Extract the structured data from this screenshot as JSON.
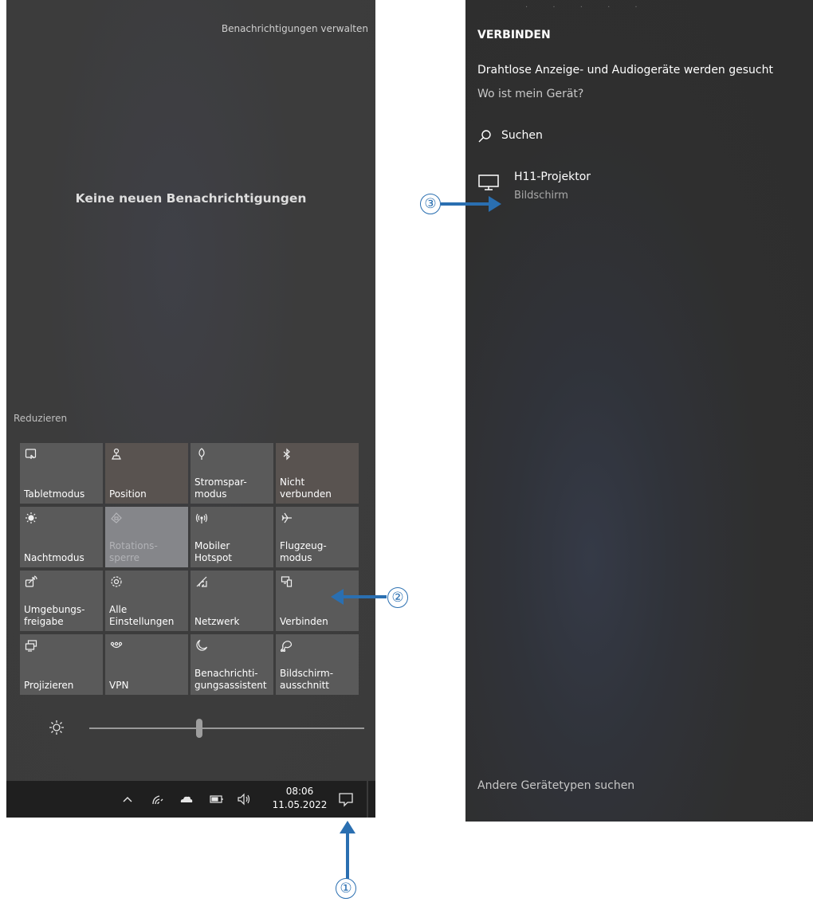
{
  "action_center": {
    "manage_notifications": "Benachrichtigungen verwalten",
    "empty_message": "Keine neuen Benachrichtigungen",
    "collapse": "Reduzieren",
    "tiles": [
      {
        "label": "Tabletmodus",
        "icon": "tablet-mode-icon"
      },
      {
        "label": "Position",
        "icon": "location-icon"
      },
      {
        "label": "Stromspar-\nmodus",
        "icon": "battery-saver-icon"
      },
      {
        "label": "Nicht\nverbunden",
        "icon": "bluetooth-icon"
      },
      {
        "label": "Nachtmodus",
        "icon": "night-light-icon"
      },
      {
        "label": "Rotations-\nsperre",
        "icon": "rotation-lock-icon"
      },
      {
        "label": "Mobiler\nHotspot",
        "icon": "mobile-hotspot-icon"
      },
      {
        "label": "Flugzeug-\nmodus",
        "icon": "airplane-icon"
      },
      {
        "label": "Umgebungs-\nfreigabe",
        "icon": "nearby-sharing-icon"
      },
      {
        "label": "Alle\nEinstellungen",
        "icon": "settings-icon"
      },
      {
        "label": "Netzwerk",
        "icon": "network-icon"
      },
      {
        "label": "Verbinden",
        "icon": "connect-icon"
      },
      {
        "label": "Projizieren",
        "icon": "project-icon"
      },
      {
        "label": "VPN",
        "icon": "vpn-icon"
      },
      {
        "label": "Benachrichti-\ngungsassistent",
        "icon": "focus-assist-icon"
      },
      {
        "label": "Bildschirm-\nausschnitt",
        "icon": "snip-icon"
      }
    ],
    "brightness_percent": 40
  },
  "taskbar": {
    "time": "08:06",
    "date": "11.05.2022",
    "tray_icons": [
      "chevron-up-icon",
      "wifi-icon",
      "onedrive-icon",
      "battery-icon",
      "volume-icon"
    ]
  },
  "connect_pane": {
    "title": "VERBINDEN",
    "status": "Drahtlose Anzeige- und Audiogeräte werden gesucht",
    "where_link": "Wo ist mein Gerät?",
    "search_label": "Suchen",
    "device": {
      "name": "H11-Projektor",
      "type": "Bildschirm"
    },
    "other_types": "Andere Gerätetypen suchen"
  },
  "callouts": [
    "①",
    "②",
    "③"
  ],
  "colors": {
    "callout": "#2a6fb1",
    "tile": "#5a5a5a",
    "taskbar": "#1f1f1f"
  }
}
